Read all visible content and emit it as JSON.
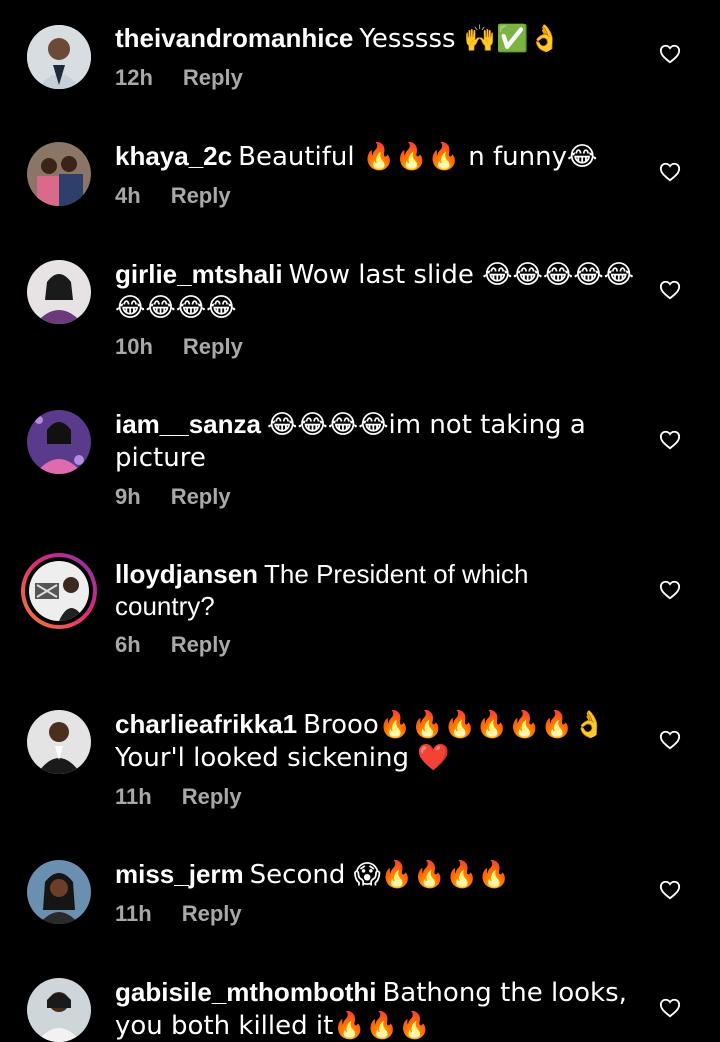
{
  "comments": [
    {
      "username": "theivandromanhice",
      "text": "Yesssss 🙌✅👌",
      "time": "12h",
      "reply": "Reply"
    },
    {
      "username": "khaya_2c",
      "text": "Beautiful 🔥🔥🔥 n funny😂",
      "time": "4h",
      "reply": "Reply"
    },
    {
      "username": "girlie_mtshali",
      "text": "Wow last slide 😂😂😂😂😂😂😂😂😂",
      "time": "10h",
      "reply": "Reply"
    },
    {
      "username": "iam__sanza",
      "text": "😂😂😂😂im not taking a picture",
      "time": "9h",
      "reply": "Reply"
    },
    {
      "username": "lloydjansen",
      "text": "The President of which country?",
      "time": "6h",
      "reply": "Reply"
    },
    {
      "username": "charlieafrikka1",
      "text": "Brooo🔥🔥🔥🔥🔥🔥👌 Your'l looked sickening ❤️",
      "time": "11h",
      "reply": "Reply"
    },
    {
      "username": "miss_jerm",
      "text": "Second 😱🔥🔥🔥🔥",
      "time": "11h",
      "reply": "Reply"
    },
    {
      "username": "gabisile_mthombothi",
      "text": "Bathong the looks, you both killed it🔥🔥🔥",
      "time": "",
      "reply": ""
    }
  ],
  "icons": {
    "like": "heart-outline-icon",
    "avatar": "profile-photo"
  },
  "colors": {
    "background": "#000000",
    "text": "#ffffff",
    "meta": "#a8a8a8",
    "story_ring_start": "#f58529",
    "story_ring_end": "#8134af"
  }
}
